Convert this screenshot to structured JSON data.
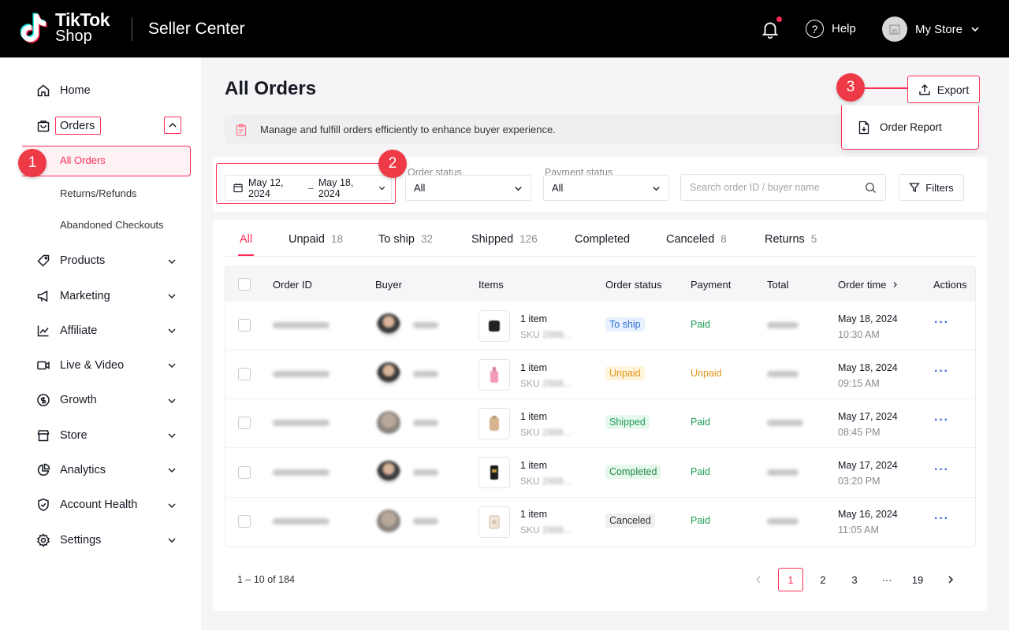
{
  "header": {
    "logo_line1": "TikTok",
    "logo_line2": "Shop",
    "product": "Seller Center",
    "help": "Help",
    "store": "My Store"
  },
  "sidebar": {
    "items": [
      {
        "label": "Home",
        "icon": "home-icon"
      },
      {
        "label": "Orders",
        "icon": "bag-icon"
      },
      {
        "label": "Products",
        "icon": "tag-icon"
      },
      {
        "label": "Marketing",
        "icon": "megaphone-icon"
      },
      {
        "label": "Affiliate",
        "icon": "chart-icon"
      },
      {
        "label": "Live & Video",
        "icon": "video-icon"
      },
      {
        "label": "Growth",
        "icon": "dollar-icon"
      },
      {
        "label": "Store",
        "icon": "storefront-icon"
      },
      {
        "label": "Analytics",
        "icon": "pie-icon"
      },
      {
        "label": "Account Health",
        "icon": "shield-icon"
      },
      {
        "label": "Settings",
        "icon": "gear-icon"
      }
    ],
    "sub_items": [
      "All Orders",
      "Returns/Refunds",
      "Abandoned Checkouts"
    ]
  },
  "badges": [
    "1",
    "2",
    "3"
  ],
  "main": {
    "title": "All Orders",
    "info": "Manage and fulfill orders efficiently to enhance buyer experience.",
    "export_label": "Export",
    "dropdown_item": "Order Report",
    "filters": {
      "date_from": "May 12, 2024",
      "date_sep": "–",
      "date_to": "May 18, 2024",
      "order_status_label": "Order status",
      "order_status_value": "All",
      "payment_status_label": "Payment status",
      "payment_status_value": "All",
      "search_placeholder": "Search order ID / buyer name",
      "filters_label": "Filters"
    },
    "tabs": [
      {
        "label": "All",
        "count": ""
      },
      {
        "label": "Unpaid",
        "count": "18"
      },
      {
        "label": "To ship",
        "count": "32"
      },
      {
        "label": "Shipped",
        "count": "126"
      },
      {
        "label": "Completed",
        "count": ""
      },
      {
        "label": "Canceled",
        "count": "8"
      },
      {
        "label": "Returns",
        "count": "5"
      }
    ],
    "columns": [
      "Order ID",
      "Buyer",
      "Items",
      "Order status",
      "Payment",
      "Total",
      "Order time",
      "Actions"
    ],
    "rows": [
      {
        "item": "1 item",
        "sku": "SKU",
        "status": "To ship",
        "payment": "Paid",
        "date": "May 18, 2024",
        "time": "10:30 AM"
      },
      {
        "item": "1 item",
        "sku": "SKU",
        "status": "Unpaid",
        "payment": "Unpaid",
        "date": "May 18, 2024",
        "time": "09:15 AM"
      },
      {
        "item": "1 item",
        "sku": "SKU",
        "status": "Shipped",
        "payment": "Paid",
        "date": "May 17, 2024",
        "time": "08:45 PM"
      },
      {
        "item": "1 item",
        "sku": "SKU",
        "status": "Completed",
        "payment": "Paid",
        "date": "May 17, 2024",
        "time": "03:20 PM"
      },
      {
        "item": "1 item",
        "sku": "SKU",
        "status": "Canceled",
        "payment": "Paid",
        "date": "May 16, 2024",
        "time": "11:05 AM"
      }
    ],
    "pagination": {
      "info": "1 – 10 of 184",
      "pages": [
        "1",
        "2",
        "3",
        "···",
        "19"
      ]
    }
  },
  "colors": {
    "accent": "#fe2c55",
    "to_ship_bg": "#e8f1ff",
    "to_ship_fg": "#2f6fd6",
    "unpaid_bg": "#fff4dc",
    "unpaid_fg": "#e3951b",
    "shipped_bg": "#e6f7ec",
    "shipped_fg": "#1f9d55",
    "completed_bg": "#e6f7ec",
    "completed_fg": "#1f8a45",
    "canceled_bg": "#efeff1",
    "canceled_fg": "#333333",
    "paid_fg": "#1f9d55"
  }
}
